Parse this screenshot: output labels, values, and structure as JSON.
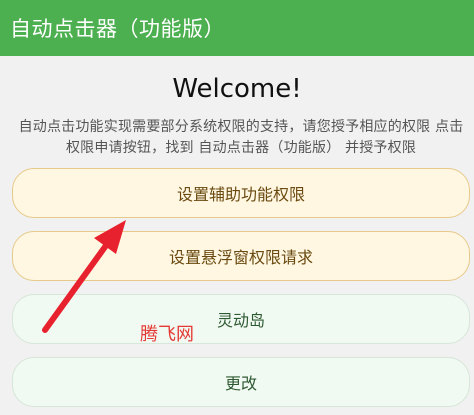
{
  "app_bar": {
    "title": "自动点击器（功能版）"
  },
  "welcome": "Welcome!",
  "description": "自动点击功能实现需要部分系统权限的支持，请您授予相应的权限 点击权限申请按钮，找到 自动点击器（功能版） 并授予权限",
  "buttons": {
    "accessibility": "设置辅助功能权限",
    "overlay": "设置悬浮窗权限请求",
    "dynamic_island": "灵动岛",
    "change": "更改"
  },
  "watermark": "腾飞网",
  "colors": {
    "app_bar": "#4caf50",
    "annotation_arrow": "#e8212f"
  }
}
